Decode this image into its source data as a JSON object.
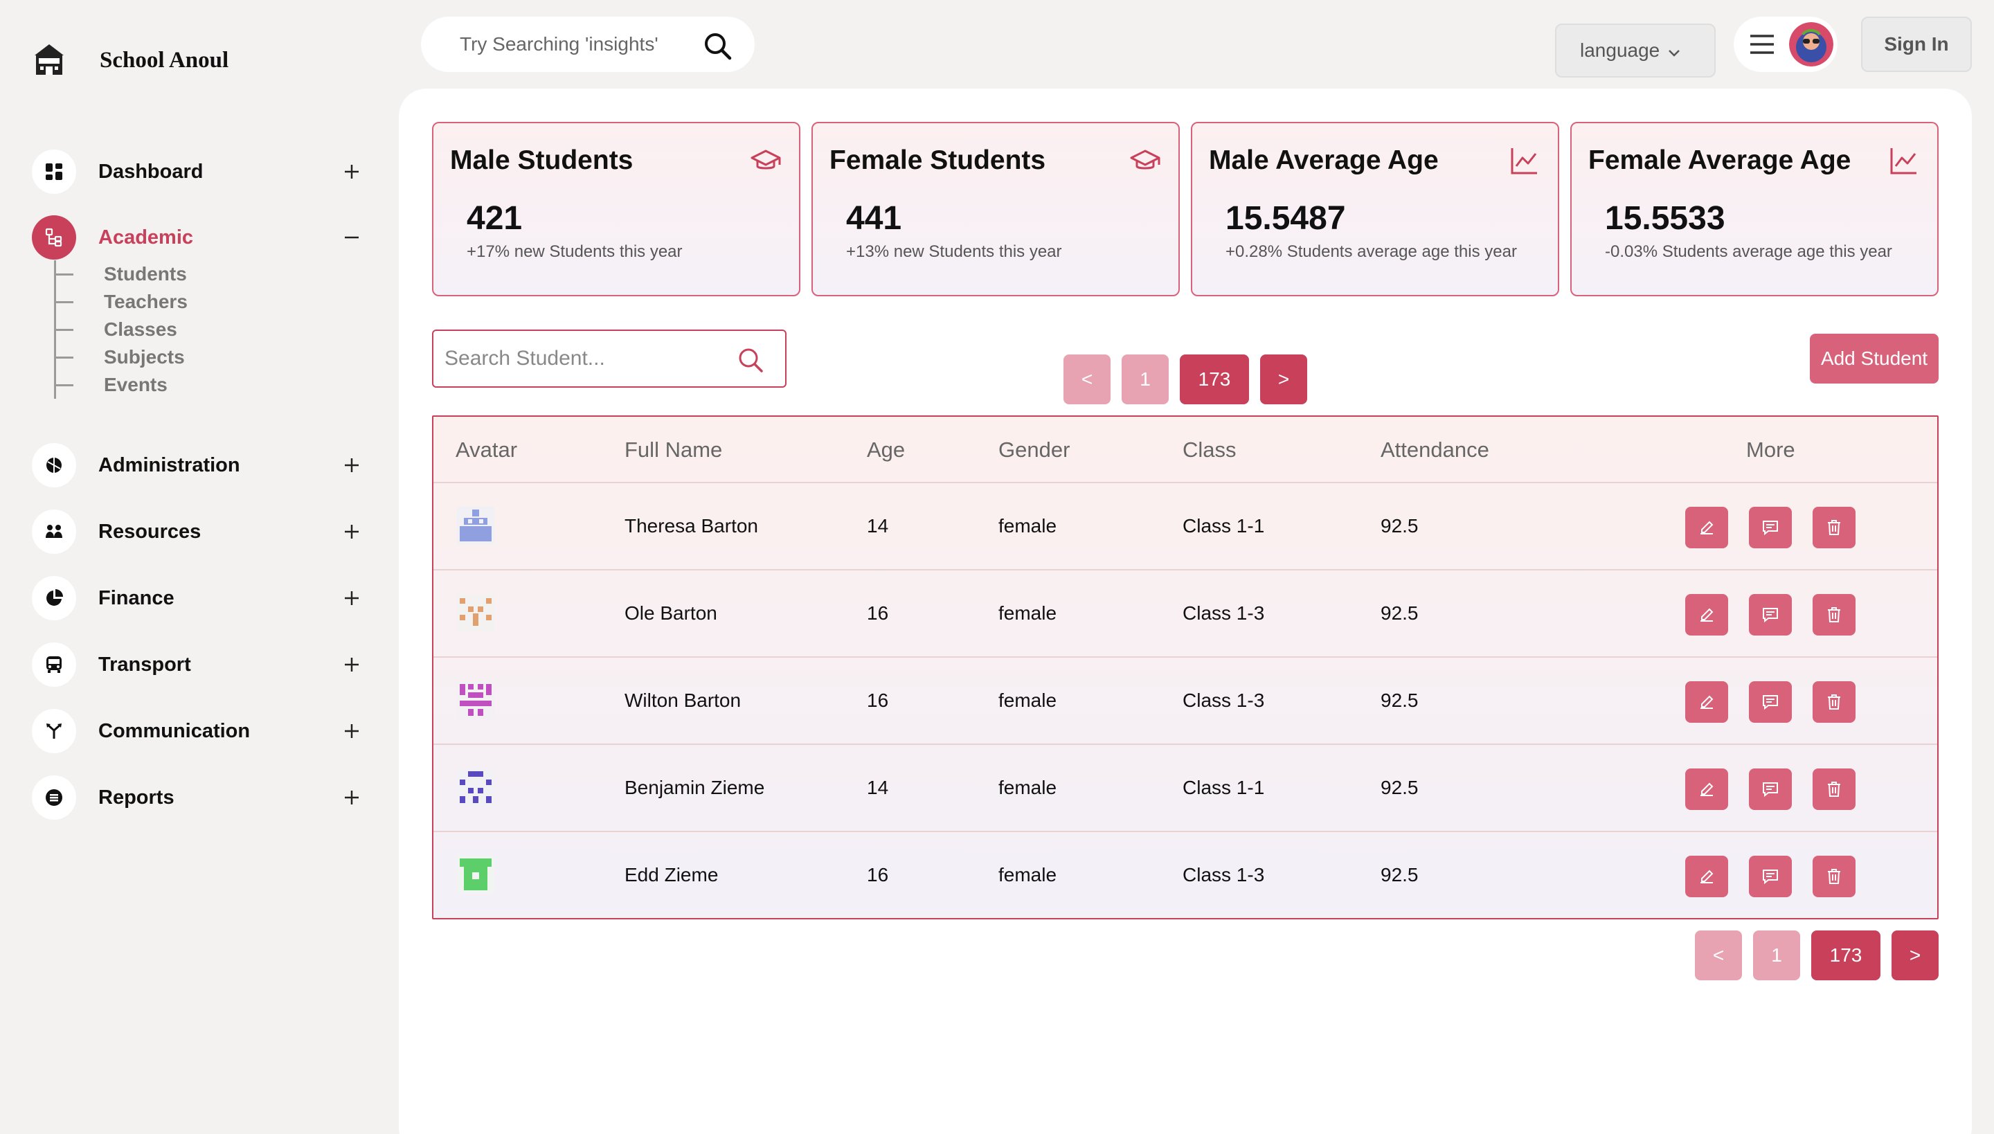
{
  "brand": {
    "name": "School Anoul"
  },
  "topbar": {
    "search_placeholder": "Try Searching 'insights'",
    "language_label": "language",
    "signin_label": "Sign In"
  },
  "sidebar": {
    "items": [
      {
        "label": "Dashboard",
        "icon": "dashboard-icon",
        "toggle": "plus"
      },
      {
        "label": "Academic",
        "icon": "academic-icon",
        "toggle": "minus",
        "active": true
      },
      {
        "label": "Administration",
        "icon": "administration-icon",
        "toggle": "plus"
      },
      {
        "label": "Resources",
        "icon": "resources-icon",
        "toggle": "plus"
      },
      {
        "label": "Finance",
        "icon": "finance-icon",
        "toggle": "plus"
      },
      {
        "label": "Transport",
        "icon": "bus-icon",
        "toggle": "plus"
      },
      {
        "label": "Communication",
        "icon": "communication-icon",
        "toggle": "plus"
      },
      {
        "label": "Reports",
        "icon": "reports-icon",
        "toggle": "plus"
      }
    ],
    "academic_sub": [
      "Students",
      "Teachers",
      "Classes",
      "Subjects",
      "Events"
    ]
  },
  "cards": [
    {
      "title": "Male Students",
      "value": "421",
      "sub": "+17% new Students this year",
      "icon": "graduation-cap-icon"
    },
    {
      "title": "Female Students",
      "value": "441",
      "sub": "+13% new Students this year",
      "icon": "graduation-cap-icon"
    },
    {
      "title": "Male Average Age",
      "value": "15.5487",
      "sub": "+0.28% Students average age this year",
      "icon": "line-chart-icon"
    },
    {
      "title": "Female Average Age",
      "value": "15.5533",
      "sub": "-0.03% Students average age this year",
      "icon": "line-chart-icon"
    }
  ],
  "student_search": {
    "placeholder": "Search Student..."
  },
  "pagination": {
    "prev": "<",
    "first": "1",
    "current": "173",
    "next": ">"
  },
  "add_student_label": "Add Student",
  "table": {
    "columns": [
      "Avatar",
      "Full Name",
      "Age",
      "Gender",
      "Class",
      "Attendance",
      "More"
    ],
    "rows": [
      {
        "name": "Theresa Barton",
        "age": "14",
        "gender": "female",
        "class": "Class 1-1",
        "attendance": "92.5",
        "avatar_color": "#8f9fe0"
      },
      {
        "name": "Ole Barton",
        "age": "16",
        "gender": "female",
        "class": "Class 1-3",
        "attendance": "92.5",
        "avatar_color": "#e0a070"
      },
      {
        "name": "Wilton Barton",
        "age": "16",
        "gender": "female",
        "class": "Class 1-3",
        "attendance": "92.5",
        "avatar_color": "#c050c0"
      },
      {
        "name": "Benjamin Zieme",
        "age": "14",
        "gender": "female",
        "class": "Class 1-1",
        "attendance": "92.5",
        "avatar_color": "#5a4ac0"
      },
      {
        "name": "Edd Zieme",
        "age": "16",
        "gender": "female",
        "class": "Class 1-3",
        "attendance": "92.5",
        "avatar_color": "#5ccf6a"
      }
    ]
  },
  "colors": {
    "accent": "#c8405a",
    "accent_light": "#d9627b",
    "accent_pale": "#e8a3b3"
  }
}
